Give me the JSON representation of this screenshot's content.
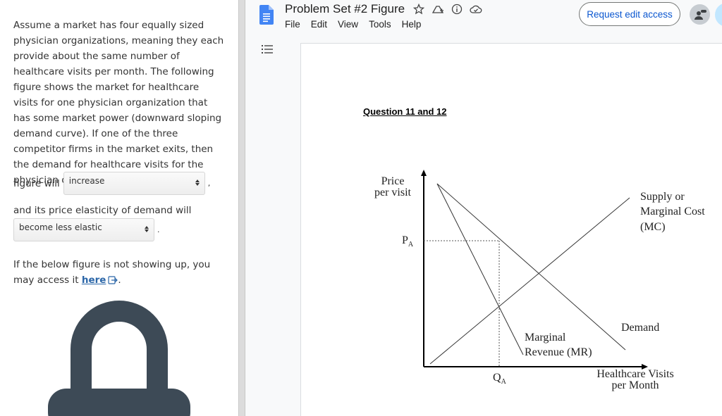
{
  "question": {
    "intro": "Assume a market has four equally sized physician organizations, meaning they each provide about the same number of healthcare visits per month. The following figure shows the market for healthcare visits for one physician organization that has some market power (downward sloping demand curve). If one of the three competitor firms in the market exits, then the demand for healthcare visits for the physician organization in the",
    "blank1_prefix": "figure will",
    "blank1_value": "increase",
    "blank1_suffix": ",",
    "blank2_prefix": "and its price elasticity of demand will",
    "blank2_value": "become less elastic",
    "blank2_suffix": ".",
    "fallback_text": "If the below figure is not showing up, you may access it",
    "fallback_link": "here",
    "fallback_end": "."
  },
  "docs": {
    "title": "Problem Set #2 Figure",
    "menu": [
      "File",
      "Edit",
      "View",
      "Tools",
      "Help"
    ],
    "request_button": "Request edit access"
  },
  "document": {
    "heading": "Question 11 and 12",
    "diagram": {
      "y_label_line1": "Price",
      "y_label_line2": "per visit",
      "price_label": "P",
      "price_sub": "A",
      "quantity_label": "Q",
      "quantity_sub": "A",
      "x_label_line1": "Healthcare Visits",
      "x_label_line2": "per Month",
      "supply_line1": "Supply or",
      "supply_line2": "Marginal Cost",
      "supply_line3": "(MC)",
      "demand_label": "Demand",
      "mr_line1": "Marginal",
      "mr_line2": "Revenue (MR)"
    }
  },
  "colors": {
    "link": "#2b66a8",
    "lock": "#3d4a56",
    "docs_blue": "#4285f4",
    "request_text": "#0b57d0"
  }
}
